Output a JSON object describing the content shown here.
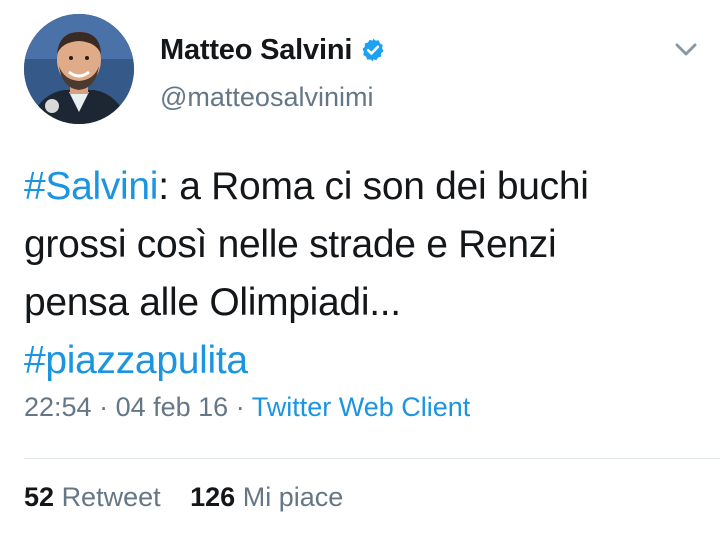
{
  "user": {
    "display_name": "Matteo Salvini",
    "handle": "@matteosalvinimi",
    "verified": true
  },
  "tweet": {
    "hashtag1": "#Salvini",
    "text_part": ": a Roma ci son dei buchi grossi così nelle strade e Renzi pensa alle Olimpiadi...",
    "hashtag2": "#piazzapulita"
  },
  "meta": {
    "time": "22:54",
    "sep1": " · ",
    "date": "04 feb 16",
    "sep2": " · ",
    "source": "Twitter Web Client"
  },
  "stats": {
    "retweets_count": "52",
    "retweets_label": "Retweet",
    "likes_count": "126",
    "likes_label": "Mi piace"
  },
  "colors": {
    "link": "#1b95e0",
    "muted": "#657786",
    "text": "#14171a",
    "verified": "#1da1f2"
  },
  "icons": {
    "verified": "verified-badge-icon",
    "menu": "chevron-down-icon"
  }
}
